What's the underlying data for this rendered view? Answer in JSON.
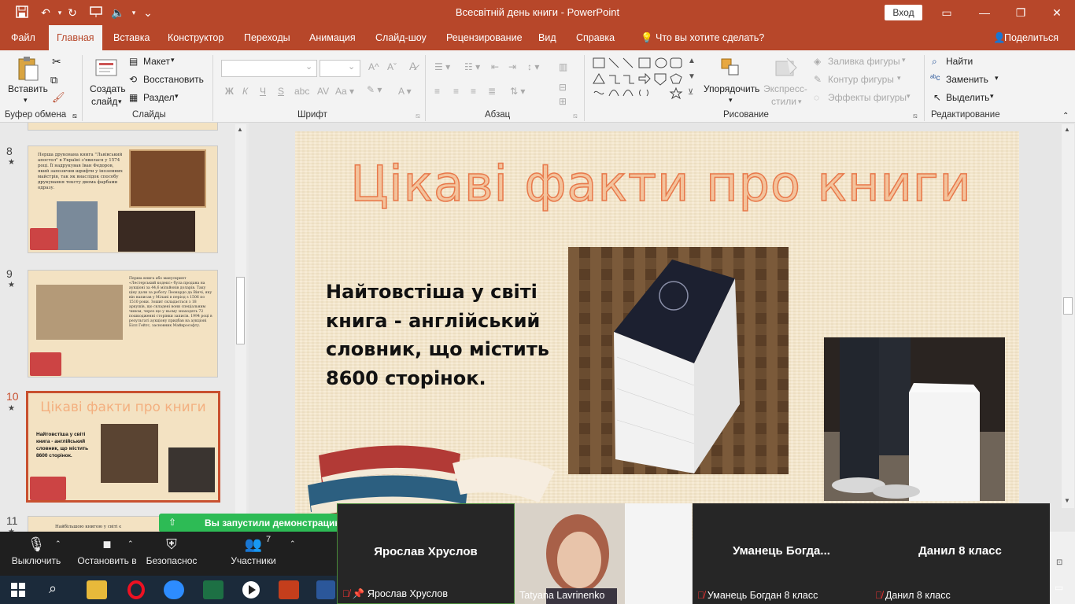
{
  "app": {
    "doc_title": "Всесвітній день книги  -  PowerPoint",
    "signin": "Вход"
  },
  "tabs": [
    {
      "label": "Файл"
    },
    {
      "label": "Главная"
    },
    {
      "label": "Вставка"
    },
    {
      "label": "Конструктор"
    },
    {
      "label": "Переходы"
    },
    {
      "label": "Анимация"
    },
    {
      "label": "Слайд-шоу"
    },
    {
      "label": "Рецензирование"
    },
    {
      "label": "Вид"
    },
    {
      "label": "Справка"
    },
    {
      "label": "Что вы хотите сделать?"
    }
  ],
  "share_label": "Поделиться",
  "ribbon": {
    "paste": "Вставить",
    "new_slide_1": "Создать",
    "new_slide_2": "слайд",
    "layout": "Макет",
    "reset": "Восстановить",
    "section": "Раздел",
    "arrange": "Упорядочить",
    "quick_styles_1": "Экспресс-",
    "quick_styles_2": "стили",
    "shape_fill": "Заливка фигуры",
    "shape_outline": "Контур фигуры",
    "shape_effects": "Эффекты фигуры",
    "find": "Найти",
    "replace": "Заменить",
    "select": "Выделить",
    "groups": {
      "clipboard": "Буфер обмена",
      "slides": "Слайды",
      "font": "Шрифт",
      "paragraph": "Абзац",
      "drawing": "Рисование",
      "editing": "Редактирование"
    },
    "font_buttons": [
      "Ж",
      "К",
      "Ч",
      "S"
    ]
  },
  "thumbnails": [
    {
      "num": "8",
      "star": "★",
      "text": "Перша друкована книга \"Львівський апостол\" в Україні з'явилася у 1574 році. Її надрукував Іван Федоров, який запозичив шрифти у іноземних майстрів, так як внаслідок способу друкування тексту двома фарбами одразу."
    },
    {
      "num": "9",
      "star": "★",
      "text": "Перша книга або манускрипт «Лестерський кодекс» була продана на аукціоні за 44,6 мільйонів доларів. Таку ціну дали за роботу Леонардо да Вінчі, яку він написав у Мілані в період з 1506 по 1510 роки. Зошит складається з 18 аркушів, що складені вони спеціальним чином, через що у ньому знаходять 72 пошкодженні сторінки записів. 1994 році в результаті аукціону придбав на аукціоні Білл Гейтс, засновник Майкрософту."
    },
    {
      "num": "10",
      "star": "★",
      "title": "Цікаві факти про книги",
      "text": "Найтовстіша у світі книга - англійський словник, що містить 8600 сторінок."
    },
    {
      "num": "11",
      "star": "★",
      "text": "Найбільшою книгою у світі є"
    }
  ],
  "slide": {
    "title": "Цікаві факти про книги",
    "body": "Найтовстіша у світі книга - англійський словник, що містить 8600 сторінок."
  },
  "zoom": {
    "notice": "Вы запустили демонстрацию",
    "mute": "Выключить",
    "video": "Остановить в",
    "security": "Безопаснос",
    "participants": "Участники",
    "participants_count": "7",
    "tiles": [
      {
        "name": "Ярослав Хруслов",
        "label": "Ярослав Хруслов"
      },
      {
        "name": "",
        "label": "Tatyana Lavrinenko"
      },
      {
        "name": "Уманець  Богда...",
        "label": "Уманець Богдан 8 класс"
      },
      {
        "name": "Данил 8 класс",
        "label": "Данил 8 класс"
      }
    ]
  }
}
